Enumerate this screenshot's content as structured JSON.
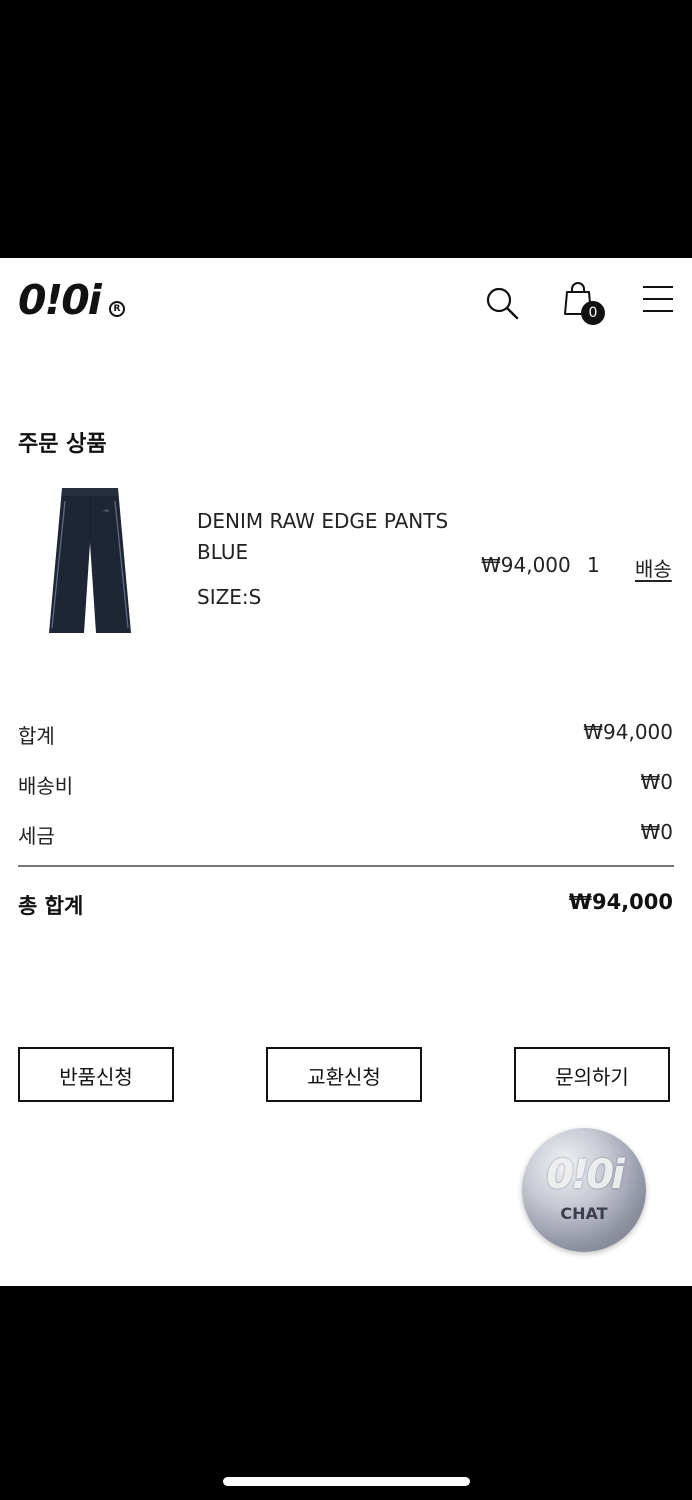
{
  "header": {
    "logo_text": "0!0i",
    "logo_reg": "R",
    "cart_count": "0"
  },
  "order": {
    "section_title": "주문 상품",
    "item": {
      "name": "DENIM RAW EDGE PANTS BLUE",
      "size": "SIZE:S",
      "price": "₩94,000",
      "quantity": "1",
      "shipping_label": "배송"
    }
  },
  "summary": {
    "subtotal_label": "합계",
    "subtotal_value": "₩94,000",
    "shipping_label": "배송비",
    "shipping_value": "₩0",
    "tax_label": "세금",
    "tax_value": "₩0",
    "total_label": "총 합계",
    "total_value": "₩94,000"
  },
  "actions": {
    "return_label": "반품신청",
    "exchange_label": "교환신청",
    "inquiry_label": "문의하기"
  },
  "chat": {
    "logo_text": "0!0i",
    "label": "CHAT"
  },
  "icons": {
    "search": "search-icon",
    "cart": "shopping-bag-icon",
    "menu": "hamburger-menu-icon"
  },
  "colors": {
    "text": "#111111",
    "background": "#ffffff",
    "divider": "#777777"
  }
}
